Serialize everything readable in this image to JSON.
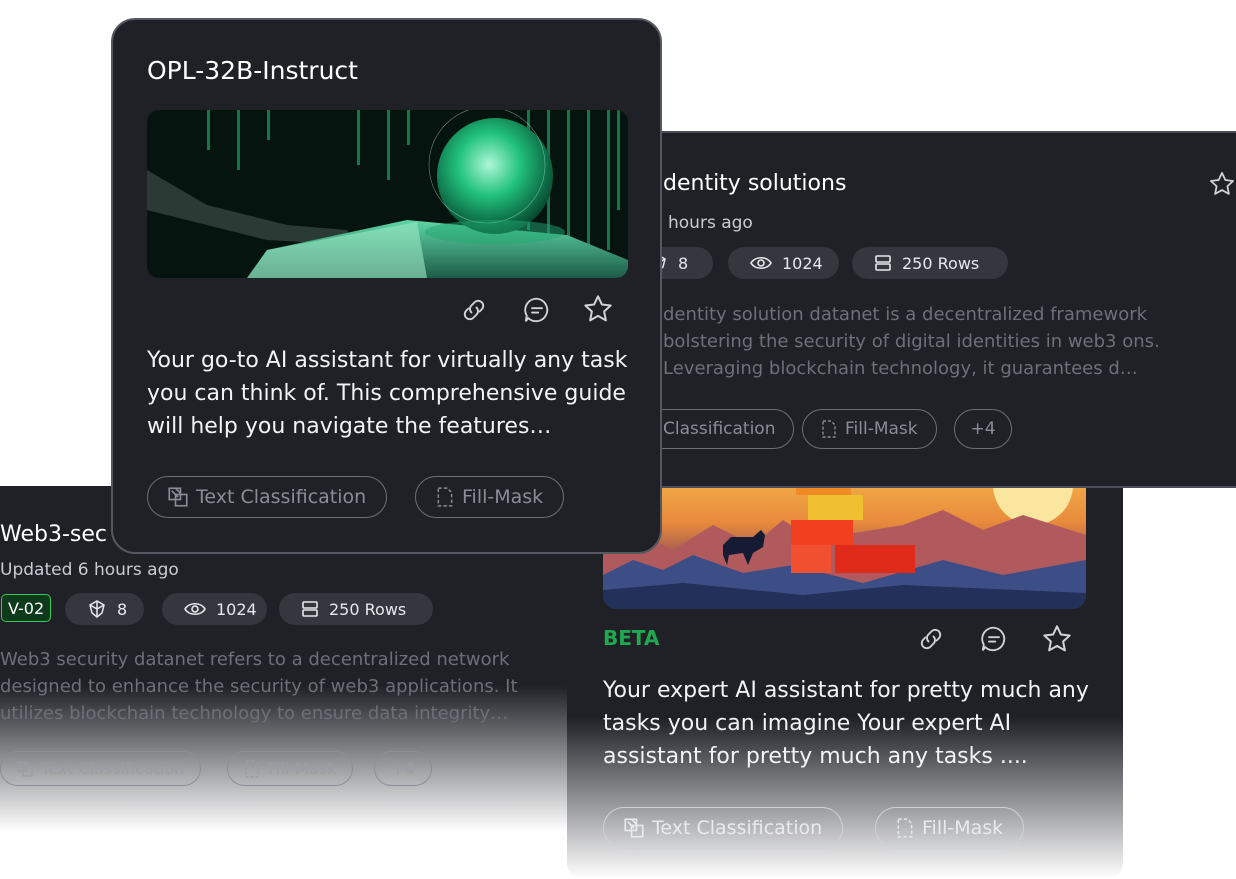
{
  "cards": {
    "web3": {
      "title": "Web3-sec",
      "updated": "Updated 6 hours ago",
      "version": "V-02",
      "models": "8",
      "views": "1024",
      "rows": "250 Rows",
      "description": "Web3 security datanet refers to a decentralized network designed to enhance the security of web3 applications. It utilizes blockchain technology to ensure data integrity…",
      "tags": [
        "Text Classification",
        "Fill-Mask",
        "+4"
      ]
    },
    "beta": {
      "badge": "BETA",
      "description": "Your expert AI assistant for  pretty much any tasks you can imagine Your expert AI assistant for  pretty much any tasks ....",
      "tags": [
        "Text Classification",
        "Fill-Mask"
      ]
    },
    "identity": {
      "title": "dentity solutions",
      "updated": "hours ago",
      "models": "8",
      "views": "1024",
      "rows": "250 Rows",
      "description": "dentity solution datanet is a decentralized framework bolstering the security of digital identities in web3 ons. Leveraging blockchain technology, it guarantees d…",
      "tags": [
        "Classification",
        "Fill-Mask",
        "+4"
      ]
    },
    "opl": {
      "title": "OPL-32B-Instruct",
      "description": "Your go-to AI assistant for virtually any task you can think of. This comprehensive guide will help you navigate the features…",
      "tags": [
        "Text Classification",
        "Fill-Mask"
      ]
    }
  },
  "icons": [
    "link-icon",
    "comment-icon",
    "star-icon",
    "models-icon",
    "eye-icon",
    "rows-icon",
    "text-classification-icon",
    "fill-mask-icon"
  ],
  "colors": {
    "card": "#1f2127",
    "chip": "#34373e",
    "beta": "#1fa84f",
    "version_bg": "#0f3a1c",
    "version_border": "#2ecc5b"
  }
}
